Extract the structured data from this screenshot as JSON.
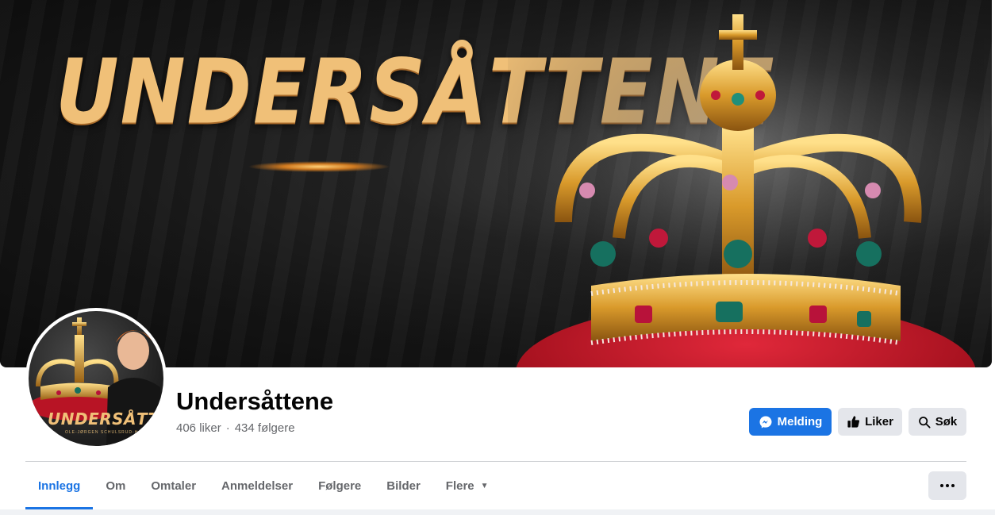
{
  "cover": {
    "title": "UNDERSÅTTENE"
  },
  "avatar": {
    "word": "UNDERSÅTTENE",
    "subtext": "OLE-JØRGEN SCHULSRUD-HANSEN"
  },
  "profile": {
    "name": "Undersåttene",
    "likes": "406 liker",
    "separator": "·",
    "followers": "434 følgere"
  },
  "actions": {
    "message_label": "Melding",
    "like_label": "Liker",
    "search_label": "Søk"
  },
  "tabs": [
    {
      "label": "Innlegg",
      "active": true
    },
    {
      "label": "Om"
    },
    {
      "label": "Omtaler"
    },
    {
      "label": "Anmeldelser"
    },
    {
      "label": "Følgere"
    },
    {
      "label": "Bilder"
    },
    {
      "label": "Flere"
    }
  ],
  "icons": {
    "message": "messenger-icon",
    "like": "thumbs-up-icon",
    "search": "search-icon",
    "more_tab": "caret-down-icon",
    "more_menu": "more-dots-icon"
  },
  "colors": {
    "accent": "#1b74e4",
    "button_gray": "#e4e6eb",
    "muted_text": "#65676b",
    "title_gold": "#f0c078"
  }
}
